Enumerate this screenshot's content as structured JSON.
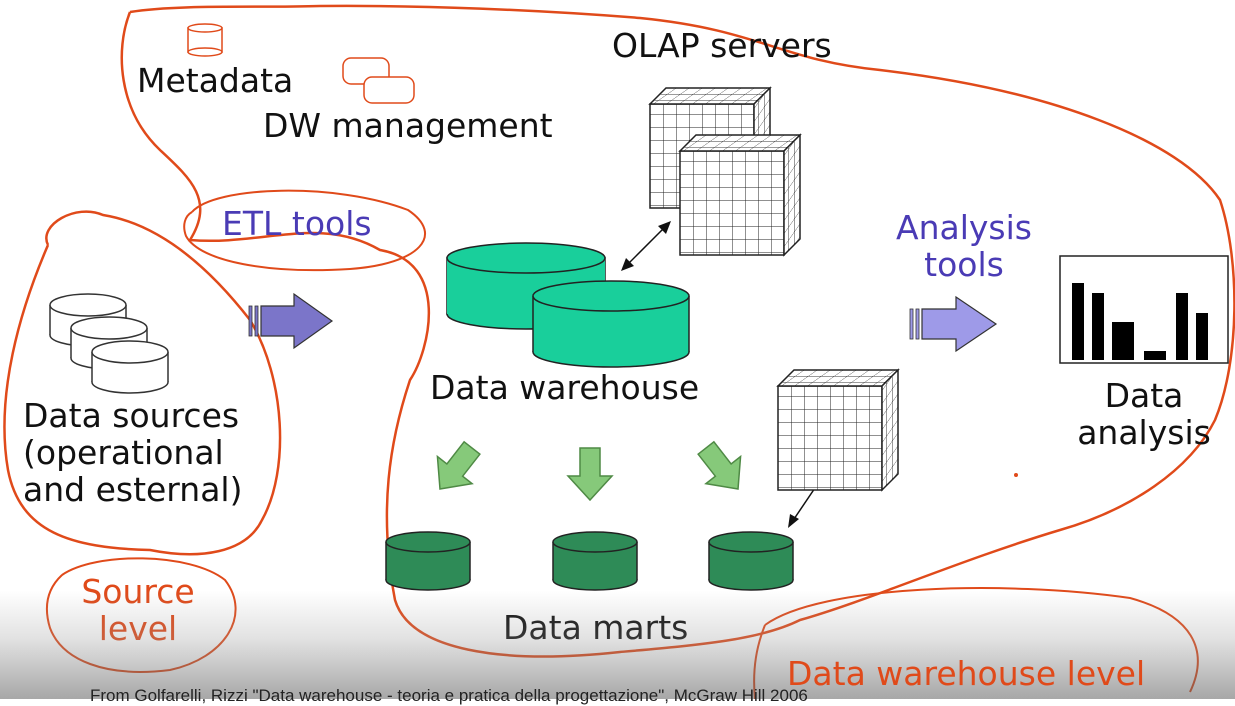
{
  "labels": {
    "metadata": "Metadata",
    "dw_management": "DW management",
    "olap_servers": "OLAP servers",
    "etl_tools": "ETL tools",
    "analysis_tools": [
      "Analysis",
      "tools"
    ],
    "data_warehouse": "Data warehouse",
    "data_sources": [
      "Data sources",
      "(operational",
      "and esternal)"
    ],
    "data_analysis": [
      "Data",
      "analysis"
    ],
    "data_marts": "Data marts",
    "source_level": [
      "Source",
      "level"
    ],
    "dw_level": "Data warehouse level"
  },
  "credit": "From Golfarelli, Rizzi \"Data warehouse - teoria e pratica della progettazione\", McGraw Hill 2006",
  "colors": {
    "annotation": "#e04a1a",
    "tool_label": "#4a3bb5",
    "warehouse": "#19cf9b",
    "mart": "#2e8b57",
    "flow_arrow": "#86c97a",
    "etl_arrow": "#7b75c9",
    "analysis_arrow": "#9e9ae8"
  },
  "icons": [
    "database-icon",
    "cube-icon",
    "bar-chart-icon",
    "arrow-icon"
  ]
}
